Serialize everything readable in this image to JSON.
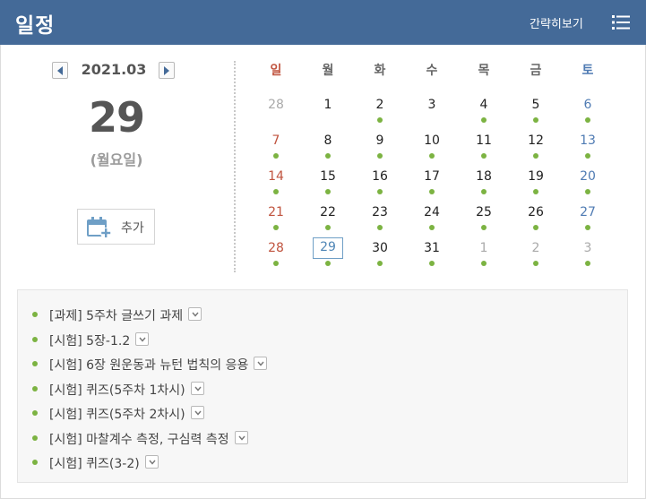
{
  "header": {
    "title": "일정",
    "simple_view_label": "간략히보기",
    "list_icon": "list-icon"
  },
  "selected": {
    "month": "2021.03",
    "day": "29",
    "weekday": "(월요일)",
    "add_label": "추가",
    "add_icon": "calendar-add-icon"
  },
  "calendar": {
    "weekdays": [
      "일",
      "월",
      "화",
      "수",
      "목",
      "금",
      "토"
    ],
    "weeks": [
      [
        {
          "n": "28",
          "other": true,
          "dot": false
        },
        {
          "n": "1",
          "other": false,
          "dot": false
        },
        {
          "n": "2",
          "other": false,
          "dot": true
        },
        {
          "n": "3",
          "other": false,
          "dot": false
        },
        {
          "n": "4",
          "other": false,
          "dot": true
        },
        {
          "n": "5",
          "other": false,
          "dot": true
        },
        {
          "n": "6",
          "other": false,
          "dot": true
        }
      ],
      [
        {
          "n": "7",
          "other": false,
          "dot": true
        },
        {
          "n": "8",
          "other": false,
          "dot": true
        },
        {
          "n": "9",
          "other": false,
          "dot": true
        },
        {
          "n": "10",
          "other": false,
          "dot": true
        },
        {
          "n": "11",
          "other": false,
          "dot": true
        },
        {
          "n": "12",
          "other": false,
          "dot": true
        },
        {
          "n": "13",
          "other": false,
          "dot": true
        }
      ],
      [
        {
          "n": "14",
          "other": false,
          "dot": true
        },
        {
          "n": "15",
          "other": false,
          "dot": true
        },
        {
          "n": "16",
          "other": false,
          "dot": true
        },
        {
          "n": "17",
          "other": false,
          "dot": true
        },
        {
          "n": "18",
          "other": false,
          "dot": true
        },
        {
          "n": "19",
          "other": false,
          "dot": true
        },
        {
          "n": "20",
          "other": false,
          "dot": true
        }
      ],
      [
        {
          "n": "21",
          "other": false,
          "dot": true
        },
        {
          "n": "22",
          "other": false,
          "dot": true
        },
        {
          "n": "23",
          "other": false,
          "dot": true
        },
        {
          "n": "24",
          "other": false,
          "dot": true
        },
        {
          "n": "25",
          "other": false,
          "dot": true
        },
        {
          "n": "26",
          "other": false,
          "dot": true
        },
        {
          "n": "27",
          "other": false,
          "dot": true
        }
      ],
      [
        {
          "n": "28",
          "other": false,
          "dot": true
        },
        {
          "n": "29",
          "other": false,
          "dot": true,
          "today": true
        },
        {
          "n": "30",
          "other": false,
          "dot": true
        },
        {
          "n": "31",
          "other": false,
          "dot": true
        },
        {
          "n": "1",
          "other": true,
          "dot": true
        },
        {
          "n": "2",
          "other": true,
          "dot": true
        },
        {
          "n": "3",
          "other": true,
          "dot": true
        }
      ]
    ]
  },
  "events": [
    {
      "text": "[과제] 5주차 글쓰기 과제"
    },
    {
      "text": "[시험] 5장-1.2"
    },
    {
      "text": "[시험] 6장 원운동과 뉴턴 법칙의 응용"
    },
    {
      "text": "[시험] 퀴즈(5주차 1차시)"
    },
    {
      "text": "[시험] 퀴즈(5주차 2차시)"
    },
    {
      "text": "[시험] 마찰계수 측정, 구심력 측정"
    },
    {
      "text": "[시험] 퀴즈(3-2)"
    }
  ],
  "colors": {
    "header": "#446a98",
    "sunday": "#c0543f",
    "saturday": "#4f7bb3",
    "dot": "#7cb342",
    "today_border": "#6f9fc6"
  }
}
